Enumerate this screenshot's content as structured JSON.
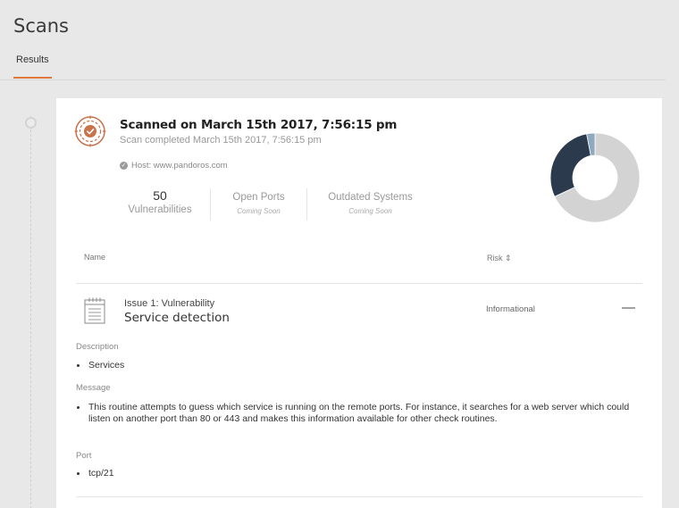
{
  "page": {
    "title": "Scans",
    "tabs": [
      {
        "label": "Results",
        "active": true
      }
    ]
  },
  "scan": {
    "title": "Scanned on March 15th 2017, 7:56:15 pm",
    "subtitle": "Scan completed March 15th 2017, 7:56:15 pm",
    "host": "Host: www.pandoros.com",
    "icon": "target-icon",
    "accent_color": "#c8734a"
  },
  "stats": [
    {
      "value": "50",
      "label": "Vulnerabilities"
    },
    {
      "label": "Open Ports",
      "sub": "Coming Soon"
    },
    {
      "label": "Outdated Systems",
      "sub": "Coming Soon"
    }
  ],
  "chart_data": {
    "type": "pie",
    "donut": true,
    "slices": [
      {
        "value": 68,
        "color": "#d3d3d3"
      },
      {
        "value": 29,
        "color": "#2b3a4d"
      },
      {
        "value": 3,
        "color": "#8fa9c0"
      }
    ]
  },
  "table": {
    "columns": {
      "name": "Name",
      "risk": "Risk ⇕"
    },
    "issues": [
      {
        "prefix": "Issue 1: Vulnerability",
        "name": "Service detection",
        "risk": "Informational",
        "toggle": "—",
        "sections": [
          {
            "label": "Description",
            "items": [
              "Services"
            ]
          },
          {
            "label": "Message",
            "items": [
              "This routine attempts to guess which service is running on the remote ports. For instance, it searches for a web server which could listen on another port than 80 or 443 and makes this information available for other check routines."
            ]
          },
          {
            "label": "Port",
            "items": [
              "tcp/21"
            ]
          }
        ]
      }
    ]
  }
}
